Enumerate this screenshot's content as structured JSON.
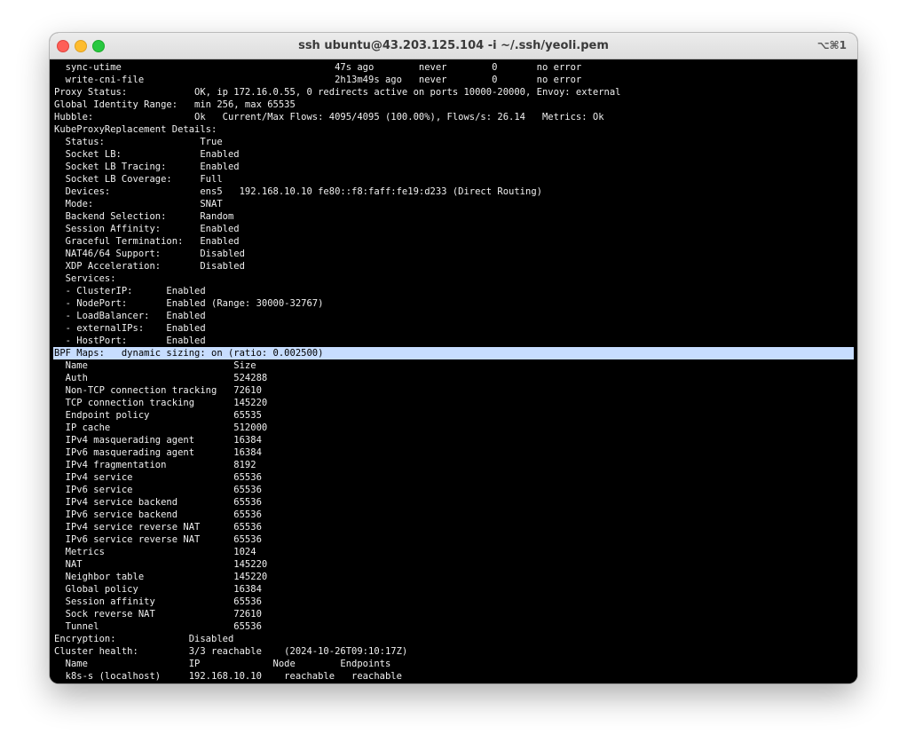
{
  "window": {
    "title": "ssh ubuntu@43.203.125.104 -i ~/.ssh/yeoli.pem",
    "shortcut": "⌥⌘1"
  },
  "terminal": {
    "lines": [
      "  sync-utime                                      47s ago        never        0       no error",
      "  write-cni-file                                  2h13m49s ago   never        0       no error",
      "Proxy Status:            OK, ip 172.16.0.55, 0 redirects active on ports 10000-20000, Envoy: external",
      "Global Identity Range:   min 256, max 65535",
      "Hubble:                  Ok   Current/Max Flows: 4095/4095 (100.00%), Flows/s: 26.14   Metrics: Ok",
      "KubeProxyReplacement Details:",
      "  Status:                 True",
      "  Socket LB:              Enabled",
      "  Socket LB Tracing:      Enabled",
      "  Socket LB Coverage:     Full",
      "  Devices:                ens5   192.168.10.10 fe80::f8:faff:fe19:d233 (Direct Routing)",
      "  Mode:                   SNAT",
      "  Backend Selection:      Random",
      "  Session Affinity:       Enabled",
      "  Graceful Termination:   Enabled",
      "  NAT46/64 Support:       Disabled",
      "  XDP Acceleration:       Disabled",
      "  Services:",
      "  - ClusterIP:      Enabled",
      "  - NodePort:       Enabled (Range: 30000-32767)",
      "  - LoadBalancer:   Enabled",
      "  - externalIPs:    Enabled",
      "  - HostPort:       Enabled",
      "BPF Maps:   dynamic sizing: on (ratio: 0.002500)",
      "  Name                          Size",
      "  Auth                          524288",
      "  Non-TCP connection tracking   72610",
      "  TCP connection tracking       145220",
      "  Endpoint policy               65535",
      "  IP cache                      512000",
      "  IPv4 masquerading agent       16384",
      "  IPv6 masquerading agent       16384",
      "  IPv4 fragmentation            8192",
      "  IPv4 service                  65536",
      "  IPv6 service                  65536",
      "  IPv4 service backend          65536",
      "  IPv6 service backend          65536",
      "  IPv4 service reverse NAT      65536",
      "  IPv6 service reverse NAT      65536",
      "  Metrics                       1024",
      "  NAT                           145220",
      "  Neighbor table                145220",
      "  Global policy                 16384",
      "  Session affinity              65536",
      "  Sock reverse NAT              72610",
      "  Tunnel                        65536",
      "Encryption:             Disabled",
      "Cluster health:         3/3 reachable    (2024-10-26T09:10:17Z)",
      "  Name                  IP             Node        Endpoints",
      "  k8s-s (localhost)     192.168.10.10    reachable   reachable"
    ],
    "highlighted_line_index": 23,
    "highlight_color": "#c7ddff"
  }
}
